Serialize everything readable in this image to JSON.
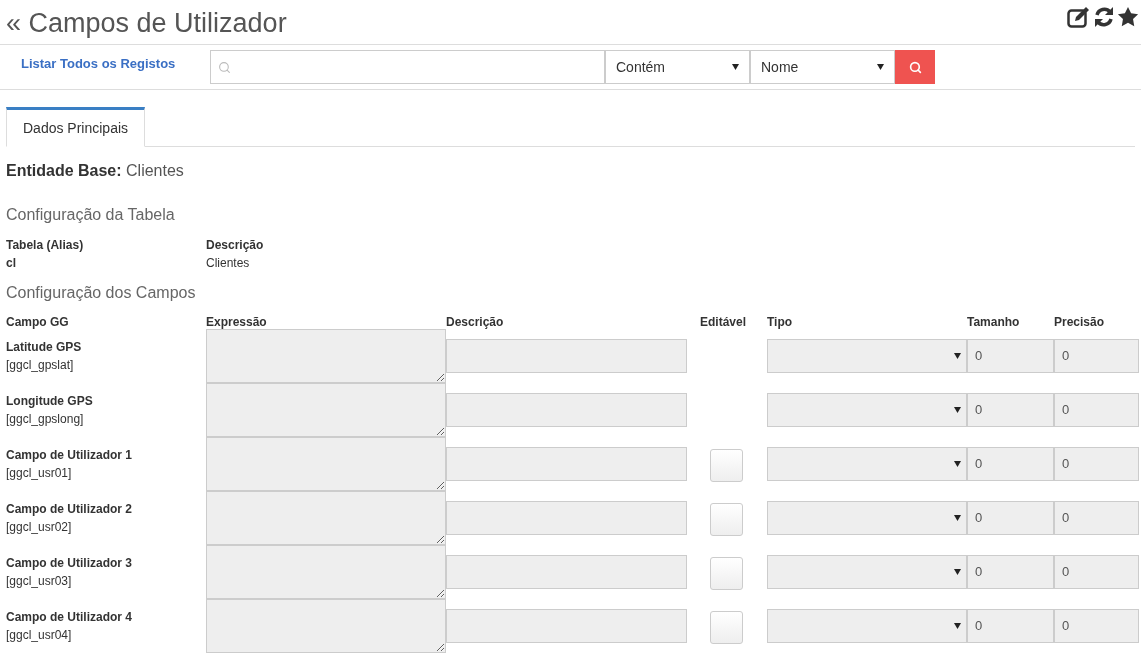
{
  "title": "« Campos de Utilizador",
  "toolbar": {
    "list_all_link": "Listar Todos os Registos",
    "operator_select": "Contém",
    "field_select": "Nome"
  },
  "tabs": [
    {
      "label": "Dados Principais",
      "selected": true
    }
  ],
  "base_entity": {
    "label": "Entidade Base:",
    "value": "Clientes"
  },
  "table_config": {
    "heading": "Configuração da Tabela",
    "columns": [
      "Tabela (Alias)",
      "Descrição"
    ],
    "values": [
      "cl",
      "Clientes"
    ]
  },
  "fields_config": {
    "heading": "Configuração dos Campos",
    "columns": [
      "Campo GG",
      "Expressão",
      "Descrição",
      "Editável",
      "Tipo",
      "Tamanho",
      "Precisão"
    ],
    "rows": [
      {
        "kind": "fixed",
        "name": "Latitude GPS",
        "code": "[ggcl_gpslat]",
        "size": "0",
        "precision": "0"
      },
      {
        "kind": "fixed",
        "name": "Longitude GPS",
        "code": "[ggcl_gpslong]",
        "size": "0",
        "precision": "0"
      },
      {
        "kind": "user",
        "name": "Campo de Utilizador 1",
        "code": "[ggcl_usr01]",
        "checked": false,
        "size": "0",
        "precision": "0"
      },
      {
        "kind": "user",
        "name": "Campo de Utilizador 2",
        "code": "[ggcl_usr02]",
        "checked": false,
        "size": "0",
        "precision": "0"
      },
      {
        "kind": "user",
        "name": "Campo de Utilizador 3",
        "code": "[ggcl_usr03]",
        "checked": false,
        "size": "0",
        "precision": "0"
      },
      {
        "kind": "user",
        "name": "Campo de Utilizador 4",
        "code": "[ggcl_usr04]",
        "checked": false,
        "size": "0",
        "precision": "0"
      }
    ]
  }
}
